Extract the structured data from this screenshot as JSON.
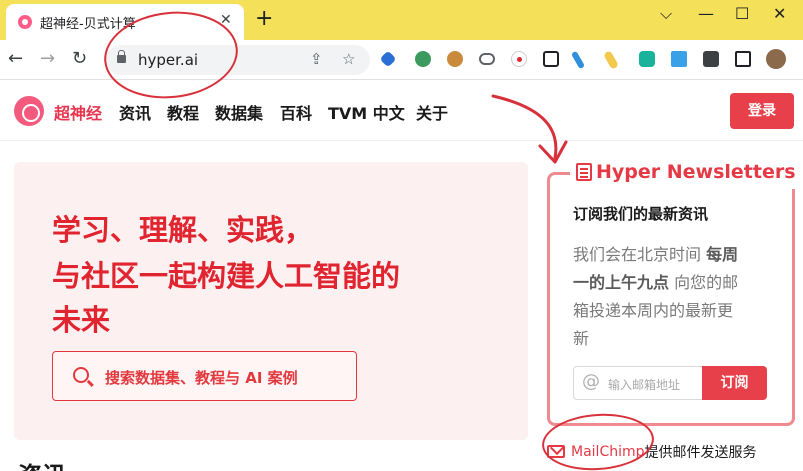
{
  "browser": {
    "tab_title": "超神经-贝式计算",
    "tab_close": "✕",
    "new_tab": "+",
    "url": "hyper.ai",
    "window_controls": [
      "⌵",
      "—",
      "☐",
      "✕"
    ]
  },
  "site": {
    "brand": "超神经",
    "nav": [
      "资讯",
      "教程",
      "数据集",
      "百科",
      "TVM 中文",
      "关于"
    ],
    "login": "登录"
  },
  "hero": {
    "line1": "学习、理解、实践，",
    "line2": "与社区一起构建人工智能的",
    "line3": "未来",
    "search_label": "搜索数据集、教程与 AI 案例",
    "next_heading": "资讯"
  },
  "newsletter": {
    "title": "Hyper Newsletters",
    "subtitle": "订阅我们的最新资讯",
    "desc_line1_a": "我们会在北京时间 ",
    "desc_line1_b": "每周",
    "desc_line2_a": "一的上午九点",
    "desc_line2_b": " 向您的邮",
    "desc_line3": "箱投递本周内的最新更",
    "desc_line4": "新",
    "input_placeholder": "输入邮箱地址",
    "subscribe": "订阅"
  },
  "footer": {
    "mail_link": "MailChimp",
    "mail_rest": " 提供邮件发送服务"
  },
  "colors": {
    "accent": "#e8404a",
    "tabstrip": "#f5e05a",
    "annotation": "#d8313b"
  }
}
